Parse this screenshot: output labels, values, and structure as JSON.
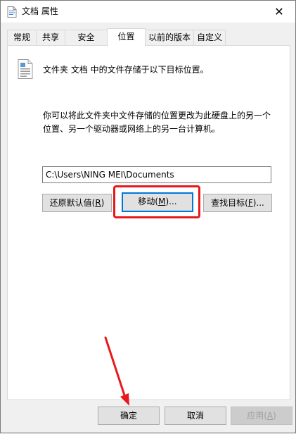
{
  "window": {
    "title": "文档 属性"
  },
  "tabs": [
    {
      "label": "常规"
    },
    {
      "label": "共享"
    },
    {
      "label": "安全"
    },
    {
      "label": "位置"
    },
    {
      "label": "以前的版本"
    },
    {
      "label": "自定义"
    }
  ],
  "location": {
    "description": "文件夹 文档 中的文件存储于以下目标位置。",
    "info_line1": "你可以将此文件夹中文件存储的位置更改为此硬盘上的另一个",
    "info_line2": "位置、另一个驱动器或网络上的另一台计算机。",
    "path_value": "C:\\Users\\NING MEI\\Documents"
  },
  "buttons": {
    "restore_label": "还原默认值(",
    "restore_key": "R",
    "restore_tail": ")",
    "move_label": "移动(",
    "move_key": "M",
    "move_tail": ")...",
    "find_label": "查找目标(",
    "find_key": "F",
    "find_tail": ")...",
    "ok": "确定",
    "cancel": "取消",
    "apply_label": "应用(",
    "apply_key": "A",
    "apply_tail": ")"
  },
  "colors": {
    "highlight": "#e8191b",
    "focus": "#0078d7"
  }
}
